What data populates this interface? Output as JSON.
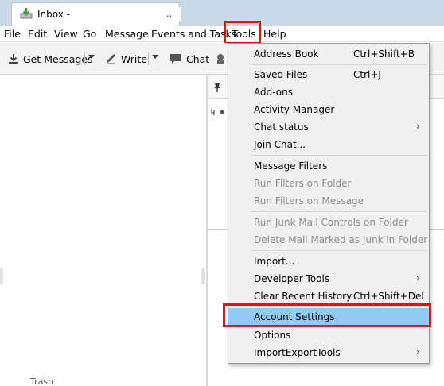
{
  "tab": {
    "title": "Inbox -",
    "trailing": ".."
  },
  "menubar": {
    "items": [
      {
        "label": "File"
      },
      {
        "label": "Edit"
      },
      {
        "label": "View"
      },
      {
        "label": "Go"
      },
      {
        "label": "Message"
      },
      {
        "label": "Events and Tasks"
      },
      {
        "label": "Tools"
      },
      {
        "label": "Help"
      }
    ]
  },
  "toolbar": {
    "get_messages": "Get Messages",
    "write": "Write",
    "chat": "Chat"
  },
  "folder_pane": {
    "trash_label": "Trash"
  },
  "tools_menu": {
    "items": [
      {
        "label": "Address Book",
        "shortcut": "Ctrl+Shift+B"
      },
      {
        "label": "Saved Files",
        "shortcut": "Ctrl+J"
      },
      {
        "label": "Add-ons",
        "shortcut": ""
      },
      {
        "label": "Activity Manager",
        "shortcut": ""
      },
      {
        "label": "Chat status",
        "shortcut": ""
      },
      {
        "label": "Join Chat...",
        "shortcut": ""
      },
      {
        "label": "Message Filters",
        "shortcut": ""
      },
      {
        "label": "Run Filters on Folder",
        "shortcut": ""
      },
      {
        "label": "Run Filters on Message",
        "shortcut": ""
      },
      {
        "label": "Run Junk Mail Controls on Folder",
        "shortcut": ""
      },
      {
        "label": "Delete Mail Marked as Junk in Folder",
        "shortcut": ""
      },
      {
        "label": "Import...",
        "shortcut": ""
      },
      {
        "label": "Developer Tools",
        "shortcut": ""
      },
      {
        "label": "Clear Recent History...",
        "shortcut": "Ctrl+Shift+Del"
      },
      {
        "label": "Account Settings",
        "shortcut": ""
      },
      {
        "label": "Options",
        "shortcut": ""
      },
      {
        "label": "ImportExportTools",
        "shortcut": ""
      }
    ],
    "submenu_arrow": "›"
  },
  "colors": {
    "highlight": "#91c9f7",
    "annotation_box": "#e0121c",
    "tab_strip": "#c9d9e8",
    "menu_bg": "#f0f0f0",
    "disabled_text": "#8d8d8d"
  },
  "icons": {
    "tab": "inbox-download-icon",
    "get_messages": "download-arrow-icon",
    "write": "pencil-icon",
    "chat": "speech-bubble-icon",
    "thread_header": "pin-icon"
  }
}
